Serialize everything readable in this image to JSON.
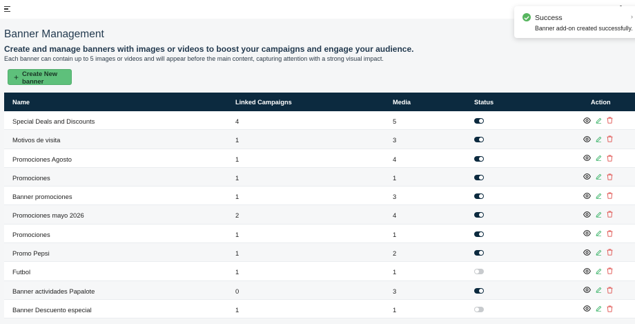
{
  "header": {
    "menu_icon": "hamburger-icon"
  },
  "page": {
    "title": "Banner Management",
    "headline": "Create and manage banners with images or videos to boost your campaigns and engage your audience.",
    "description": "Each banner can contain up to 5 images or videos and will appear before the main content, capturing attention with a strong visual impact.",
    "create_button": {
      "icon": "plus-icon",
      "label": "Create New banner"
    }
  },
  "table": {
    "columns": {
      "name": "Name",
      "linked": "Linked Campaigns",
      "media": "Media",
      "status": "Status",
      "action": "Action"
    },
    "rows": [
      {
        "name": "Special Deals and Discounts",
        "linked": "4",
        "media": "5",
        "active": true
      },
      {
        "name": "Motivos de visita",
        "linked": "1",
        "media": "3",
        "active": true
      },
      {
        "name": "Promociones Agosto",
        "linked": "1",
        "media": "4",
        "active": true
      },
      {
        "name": "Promociones",
        "linked": "1",
        "media": "1",
        "active": true
      },
      {
        "name": "Banner promociones",
        "linked": "1",
        "media": "3",
        "active": true
      },
      {
        "name": "Promociones mayo 2026",
        "linked": "2",
        "media": "4",
        "active": true
      },
      {
        "name": "Promociones",
        "linked": "1",
        "media": "1",
        "active": true
      },
      {
        "name": "Promo Pepsi",
        "linked": "1",
        "media": "2",
        "active": true
      },
      {
        "name": "Futbol",
        "linked": "1",
        "media": "1",
        "active": false
      },
      {
        "name": "Banner actividades Papalote",
        "linked": "0",
        "media": "3",
        "active": true
      },
      {
        "name": "Banner Descuento especial",
        "linked": "1",
        "media": "1",
        "active": false
      }
    ],
    "action_icons": [
      "eye-icon",
      "pencil-icon",
      "trash-icon"
    ]
  },
  "toast": {
    "title": "Success",
    "message": "Banner add-on created successfully.",
    "icon": "check-circle-icon"
  },
  "colors": {
    "header_bg": "#0c2a3f",
    "primary_button": "#5ec07b",
    "toggle_on": "#0c2a3f",
    "toggle_off": "#c8cbce",
    "edit_icon": "#3fb56b",
    "delete_icon": "#e0524f",
    "success": "#57b55f"
  }
}
